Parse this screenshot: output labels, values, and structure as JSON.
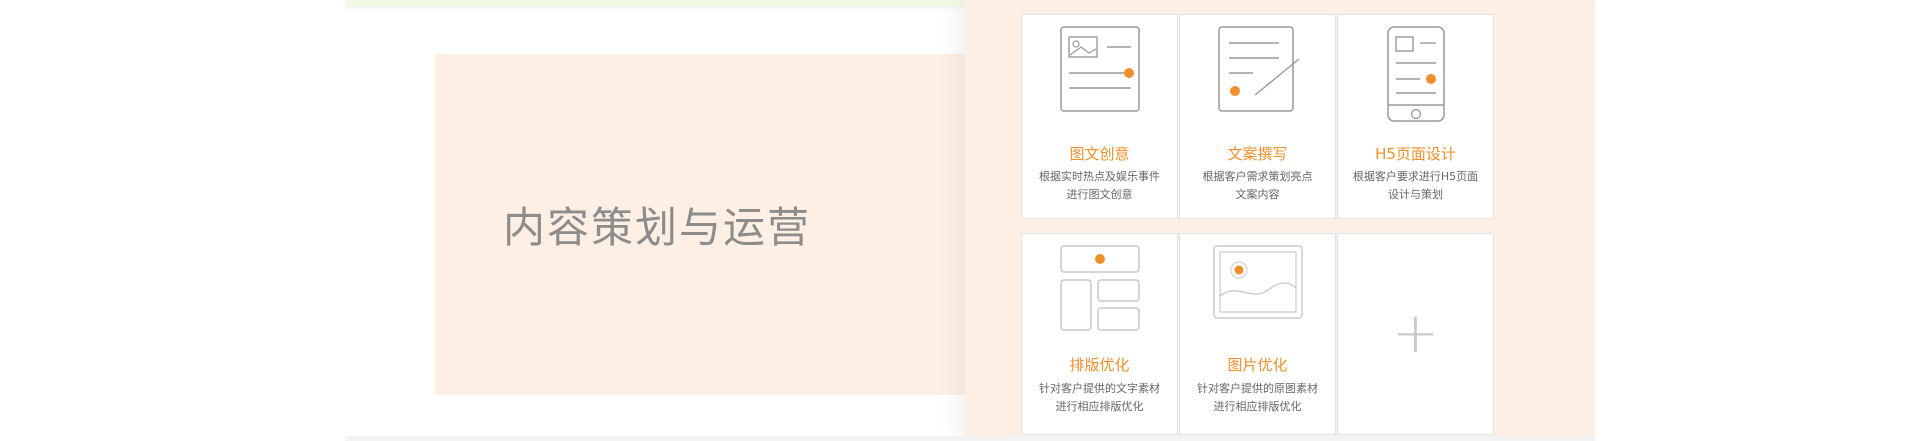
{
  "section": {
    "title": "内容策划与运营"
  },
  "services": [
    {
      "title": "图文创意",
      "desc_line1": "根据实时热点及娱乐事件",
      "desc_line2": "进行图文创意",
      "icon": "image-text-icon"
    },
    {
      "title": "文案撰写",
      "desc_line1": "根据客户需求策划亮点",
      "desc_line2": "文案内容",
      "icon": "document-edit-icon"
    },
    {
      "title": "H5页面设计",
      "desc_line1": "根据客户要求进行H5页面",
      "desc_line2": "设计与策划",
      "icon": "mobile-page-icon"
    },
    {
      "title": "排版优化",
      "desc_line1": "针对客户提供的文字素材",
      "desc_line2": "进行相应排版优化",
      "icon": "layout-icon"
    },
    {
      "title": "图片优化",
      "desc_line1": "针对客户提供的原图素材",
      "desc_line2": "进行相应排版优化",
      "icon": "picture-icon"
    },
    {
      "title": "",
      "icon": "plus-icon",
      "symbol": "+"
    }
  ],
  "colors": {
    "accent": "#f0902d",
    "panel_bg": "#fdefe3",
    "title_gray": "#8c8c8c",
    "card_border": "#e3e3e3"
  }
}
